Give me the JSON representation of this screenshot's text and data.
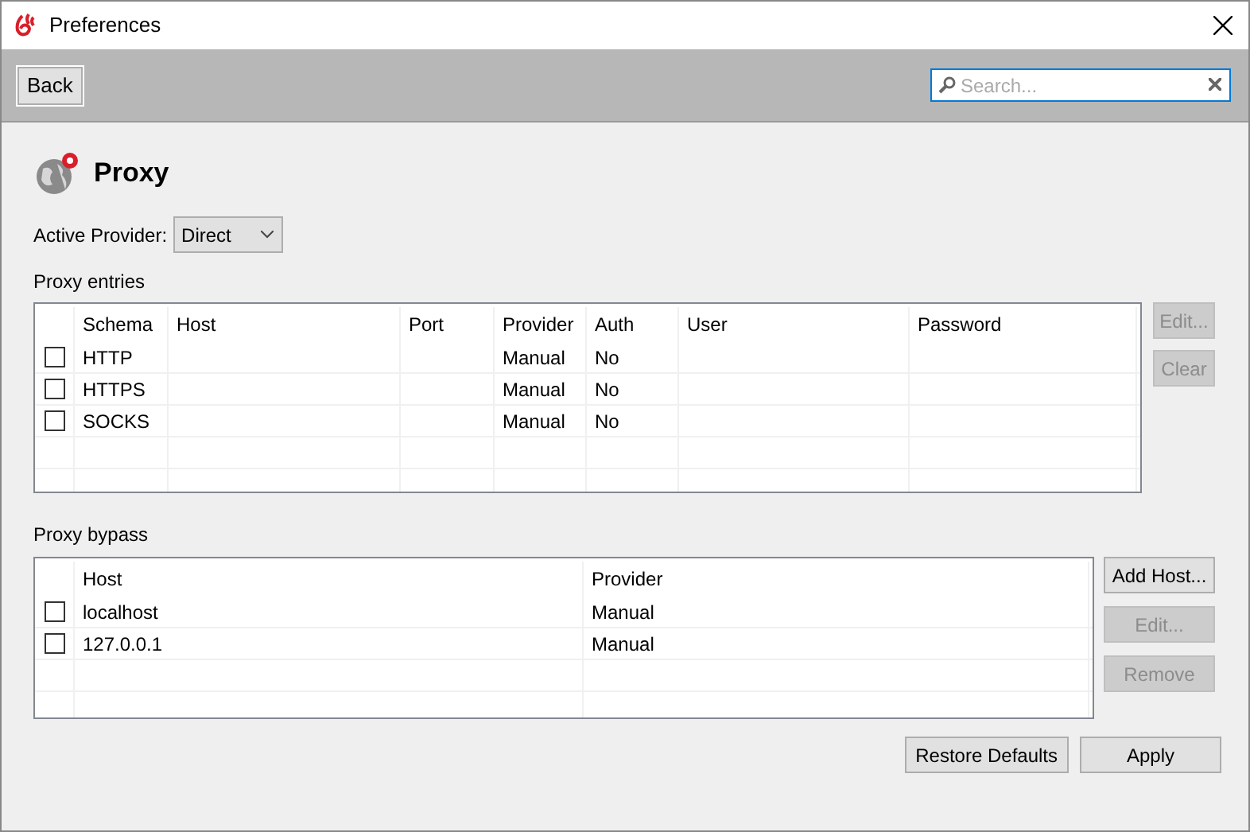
{
  "window": {
    "title": "Preferences"
  },
  "toolbar": {
    "back_button": {
      "label": "Back"
    },
    "search": {
      "placeholder": "Search..."
    }
  },
  "page": {
    "title": "Proxy",
    "active_provider": {
      "label": "Active Provider:",
      "value": "Direct"
    }
  },
  "proxy_entries": {
    "title": "Proxy entries",
    "columns": [
      "Schema",
      "Host",
      "Port",
      "Provider",
      "Auth",
      "User",
      "Password"
    ],
    "rows": [
      {
        "checked": false,
        "cells": [
          "HTTP",
          "",
          "",
          "Manual",
          "No",
          "",
          ""
        ]
      },
      {
        "checked": false,
        "cells": [
          "HTTPS",
          "",
          "",
          "Manual",
          "No",
          "",
          ""
        ]
      },
      {
        "checked": false,
        "cells": [
          "SOCKS",
          "",
          "",
          "Manual",
          "No",
          "",
          ""
        ]
      }
    ],
    "buttons": [
      {
        "label": "Edit...",
        "disabled": true
      },
      {
        "label": "Clear",
        "disabled": true
      }
    ]
  },
  "proxy_bypass": {
    "title": "Proxy bypass",
    "columns": [
      "Host",
      "Provider"
    ],
    "rows": [
      {
        "checked": false,
        "cells": [
          "localhost",
          "Manual"
        ]
      },
      {
        "checked": false,
        "cells": [
          "127.0.0.1",
          "Manual"
        ]
      }
    ],
    "buttons": [
      {
        "label": "Add Host...",
        "disabled": false
      },
      {
        "label": "Edit...",
        "disabled": true
      },
      {
        "label": "Remove",
        "disabled": true
      }
    ]
  },
  "footer_buttons": [
    {
      "label": "Restore Defaults"
    },
    {
      "label": "Apply"
    }
  ]
}
